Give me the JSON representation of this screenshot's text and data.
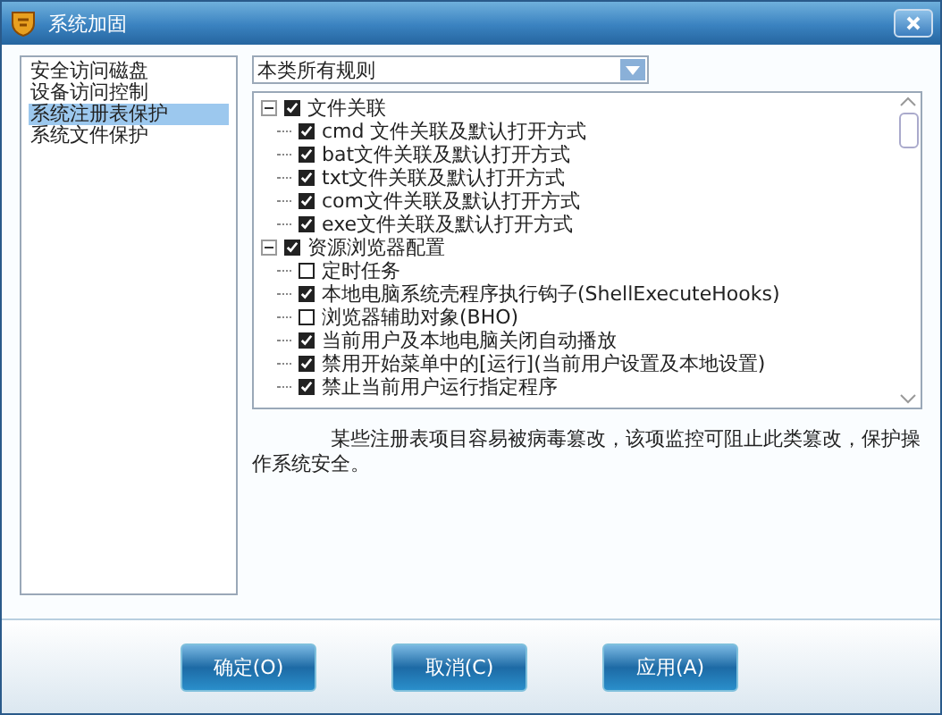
{
  "window": {
    "title": "系统加固"
  },
  "sidebar": {
    "items": [
      {
        "label": "安全访问磁盘",
        "selected": false
      },
      {
        "label": "设备访问控制",
        "selected": false
      },
      {
        "label": "系统注册表保护",
        "selected": true
      },
      {
        "label": "系统文件保护",
        "selected": false
      }
    ]
  },
  "filter": {
    "value": "本类所有规则"
  },
  "tree": [
    {
      "label": "文件关联",
      "checked": true,
      "expanded": true,
      "children": [
        {
          "label": "cmd 文件关联及默认打开方式",
          "checked": true
        },
        {
          "label": "bat文件关联及默认打开方式",
          "checked": true
        },
        {
          "label": "txt文件关联及默认打开方式",
          "checked": true
        },
        {
          "label": "com文件关联及默认打开方式",
          "checked": true
        },
        {
          "label": "exe文件关联及默认打开方式",
          "checked": true
        }
      ]
    },
    {
      "label": "资源浏览器配置",
      "checked": true,
      "expanded": true,
      "children": [
        {
          "label": "定时任务",
          "checked": false
        },
        {
          "label": "本地电脑系统壳程序执行钩子(ShellExecuteHooks)",
          "checked": true
        },
        {
          "label": "浏览器辅助对象(BHO)",
          "checked": false
        },
        {
          "label": "当前用户及本地电脑关闭自动播放",
          "checked": true
        },
        {
          "label": "禁用开始菜单中的[运行](当前用户设置及本地设置)",
          "checked": true
        },
        {
          "label": "禁止当前用户运行指定程序",
          "checked": true
        }
      ]
    }
  ],
  "description": "某些注册表项目容易被病毒篡改，该项监控可阻止此类篡改，保护操作系统安全。",
  "buttons": [
    "确定(O)",
    "取消(C)",
    "应用(A)"
  ]
}
